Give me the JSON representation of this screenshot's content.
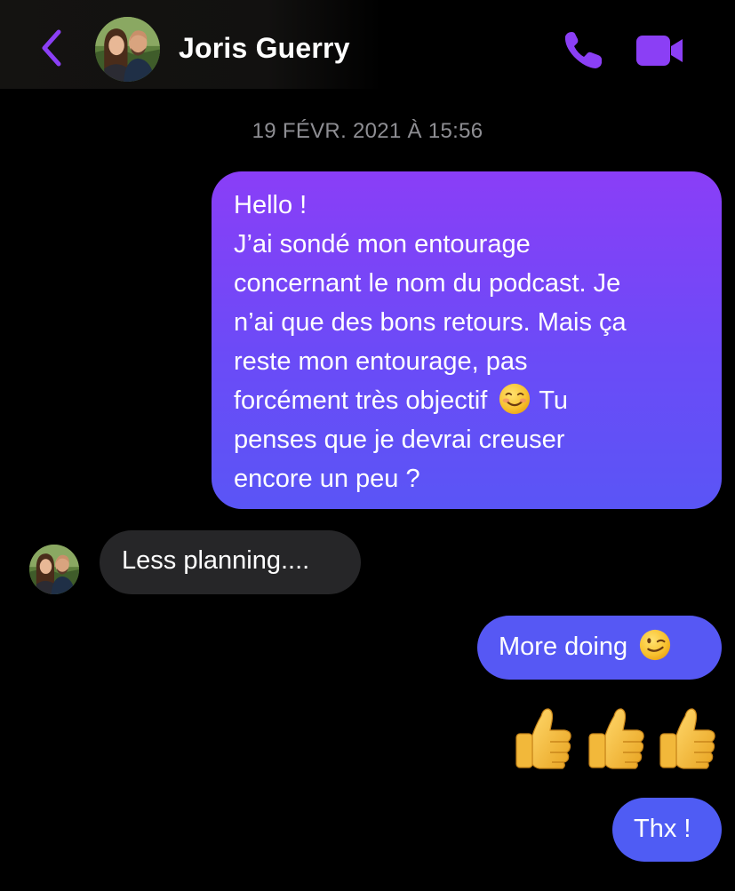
{
  "header": {
    "contact_name": "Joris Guerry",
    "back_icon": "chevron-left-icon",
    "call_icon": "phone-icon",
    "video_icon": "video-camera-icon",
    "accent_color": "#8b3ff5"
  },
  "conversation": {
    "timestamp": "19 FÉVR. 2021 À 15:56",
    "messages": [
      {
        "direction": "outgoing",
        "lines": [
          "Hello !",
          "J’ai sondé mon entourage",
          "concernant le nom du podcast. Je",
          "n’ai que des bons retours. Mais ça",
          "reste mon entourage, pas",
          "forcément très objectif",
          "Tu",
          "penses que je devrai creuser",
          "encore un peu ?"
        ],
        "emoji": "smiling-face-emoji"
      },
      {
        "direction": "incoming",
        "text": "Less planning....",
        "avatar": "contact-avatar"
      },
      {
        "direction": "outgoing",
        "text": "More doing",
        "emoji": "winking-face-emoji"
      },
      {
        "direction": "outgoing",
        "type": "emoji-only",
        "emojis": [
          "thumbs-up-emoji",
          "thumbs-up-emoji",
          "thumbs-up-emoji"
        ]
      },
      {
        "direction": "outgoing",
        "text": "Thx !"
      }
    ]
  },
  "colors": {
    "background": "#000000",
    "outgoing_bubble_top": "#8a3ef7",
    "outgoing_bubble_bottom": "#5658f4",
    "incoming_bubble": "#262628",
    "timestamp": "#8e8e93"
  }
}
